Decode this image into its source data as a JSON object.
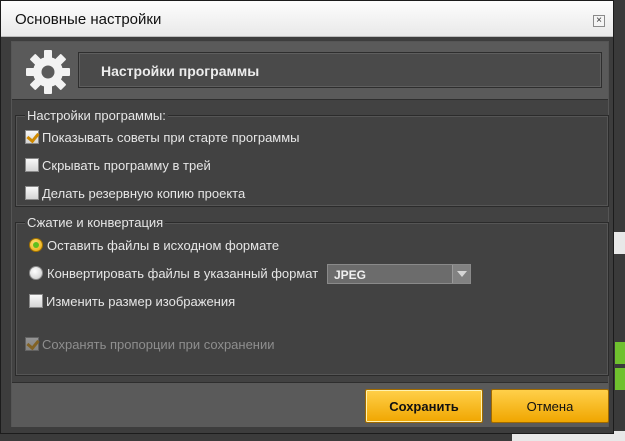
{
  "window": {
    "title": "Основные настройки",
    "close_glyph": "×"
  },
  "header": {
    "icon": "gear-icon",
    "title": "Настройки программы"
  },
  "program_settings": {
    "group_title": "Настройки программы:",
    "options": [
      {
        "label": "Показывать советы при старте программы",
        "checked": true
      },
      {
        "label": "Скрывать программу в трей",
        "checked": false
      },
      {
        "label": "Делать резервную копию проекта",
        "checked": false
      }
    ]
  },
  "compression": {
    "group_title": "Сжатие и конвертация",
    "keep_format_label": "Оставить файлы в исходном формате",
    "convert_label": "Конвертировать файлы в указанный формат",
    "format_value": "JPEG",
    "resize_label": "Изменить размер изображения",
    "keep_proportions_label": "Сохранять пропорции при сохранении",
    "selected_mode": "keep"
  },
  "buttons": {
    "save_label": "Сохранить",
    "cancel_label": "Отмена"
  },
  "colors": {
    "accent": "#f0a600",
    "background": "#3d3d3d"
  }
}
